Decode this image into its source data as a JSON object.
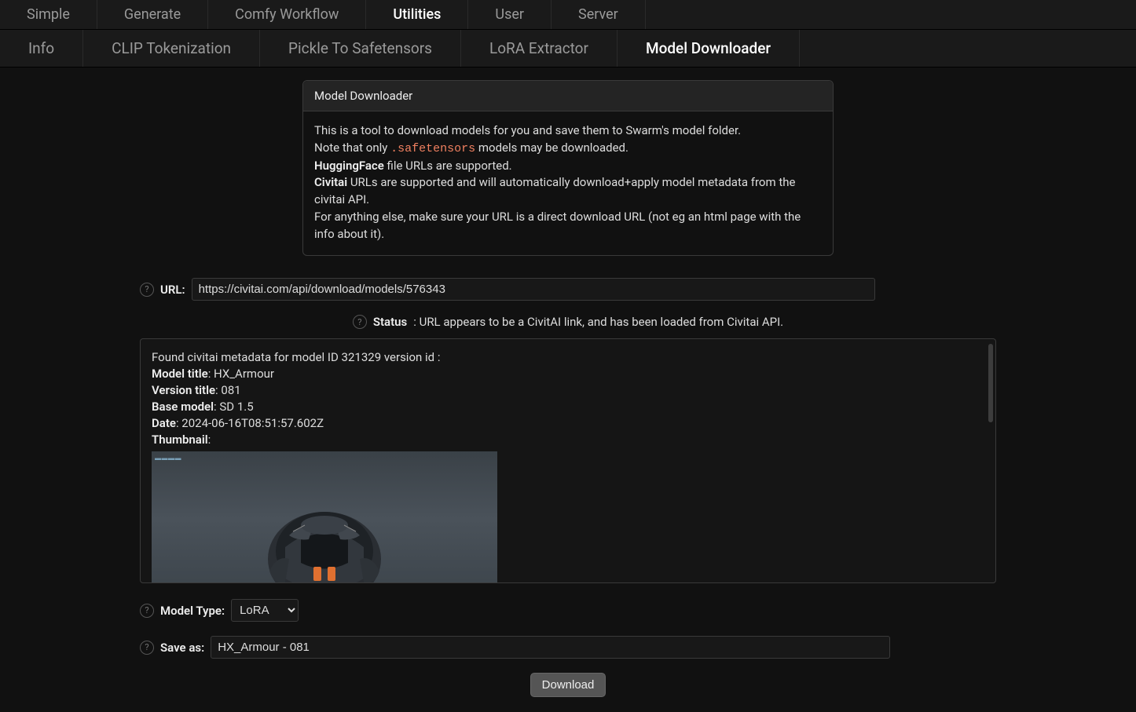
{
  "tabs_primary": [
    {
      "label": "Simple",
      "active": false
    },
    {
      "label": "Generate",
      "active": false
    },
    {
      "label": "Comfy Workflow",
      "active": false
    },
    {
      "label": "Utilities",
      "active": true
    },
    {
      "label": "User",
      "active": false
    },
    {
      "label": "Server",
      "active": false
    }
  ],
  "tabs_secondary": [
    {
      "label": "Info",
      "active": false
    },
    {
      "label": "CLIP Tokenization",
      "active": false
    },
    {
      "label": "Pickle To Safetensors",
      "active": false
    },
    {
      "label": "LoRA Extractor",
      "active": false
    },
    {
      "label": "Model Downloader",
      "active": true
    }
  ],
  "card": {
    "title": "Model Downloader",
    "line1": "This is a tool to download models for you and save them to Swarm's model folder.",
    "line2a": "Note that only ",
    "line2code": ".safetensors",
    "line2b": " models may be downloaded.",
    "line3bold": "HuggingFace",
    "line3rest": " file URLs are supported.",
    "line4bold": "Civitai",
    "line4rest": " URLs are supported and will automatically download+apply model metadata from the civitai API.",
    "line5": "For anything else, make sure your URL is a direct download URL (not eg an html page with the info about it)."
  },
  "form": {
    "url_label": "URL:",
    "url_value": "https://civitai.com/api/download/models/576343",
    "status_label": "Status",
    "status_text": ": URL appears to be a CivitAI link, and has been loaded from Civitai API.",
    "model_type_label": "Model Type:",
    "model_type_value": "LoRA",
    "save_as_label": "Save as:",
    "save_as_value": "HX_Armour - 081",
    "download_label": "Download"
  },
  "meta": {
    "found_line": "Found civitai metadata for model ID 321329 version id :",
    "model_title_label": "Model title",
    "model_title_value": ": HX_Armour",
    "version_title_label": "Version title",
    "version_title_value": ": 081",
    "base_model_label": "Base model",
    "base_model_value": ": SD 1.5",
    "date_label": "Date",
    "date_value": ": 2024-06-16T08:51:57.602Z",
    "thumbnail_label": "Thumbnail",
    "thumbnail_suffix": ":"
  },
  "help_glyph": "?"
}
